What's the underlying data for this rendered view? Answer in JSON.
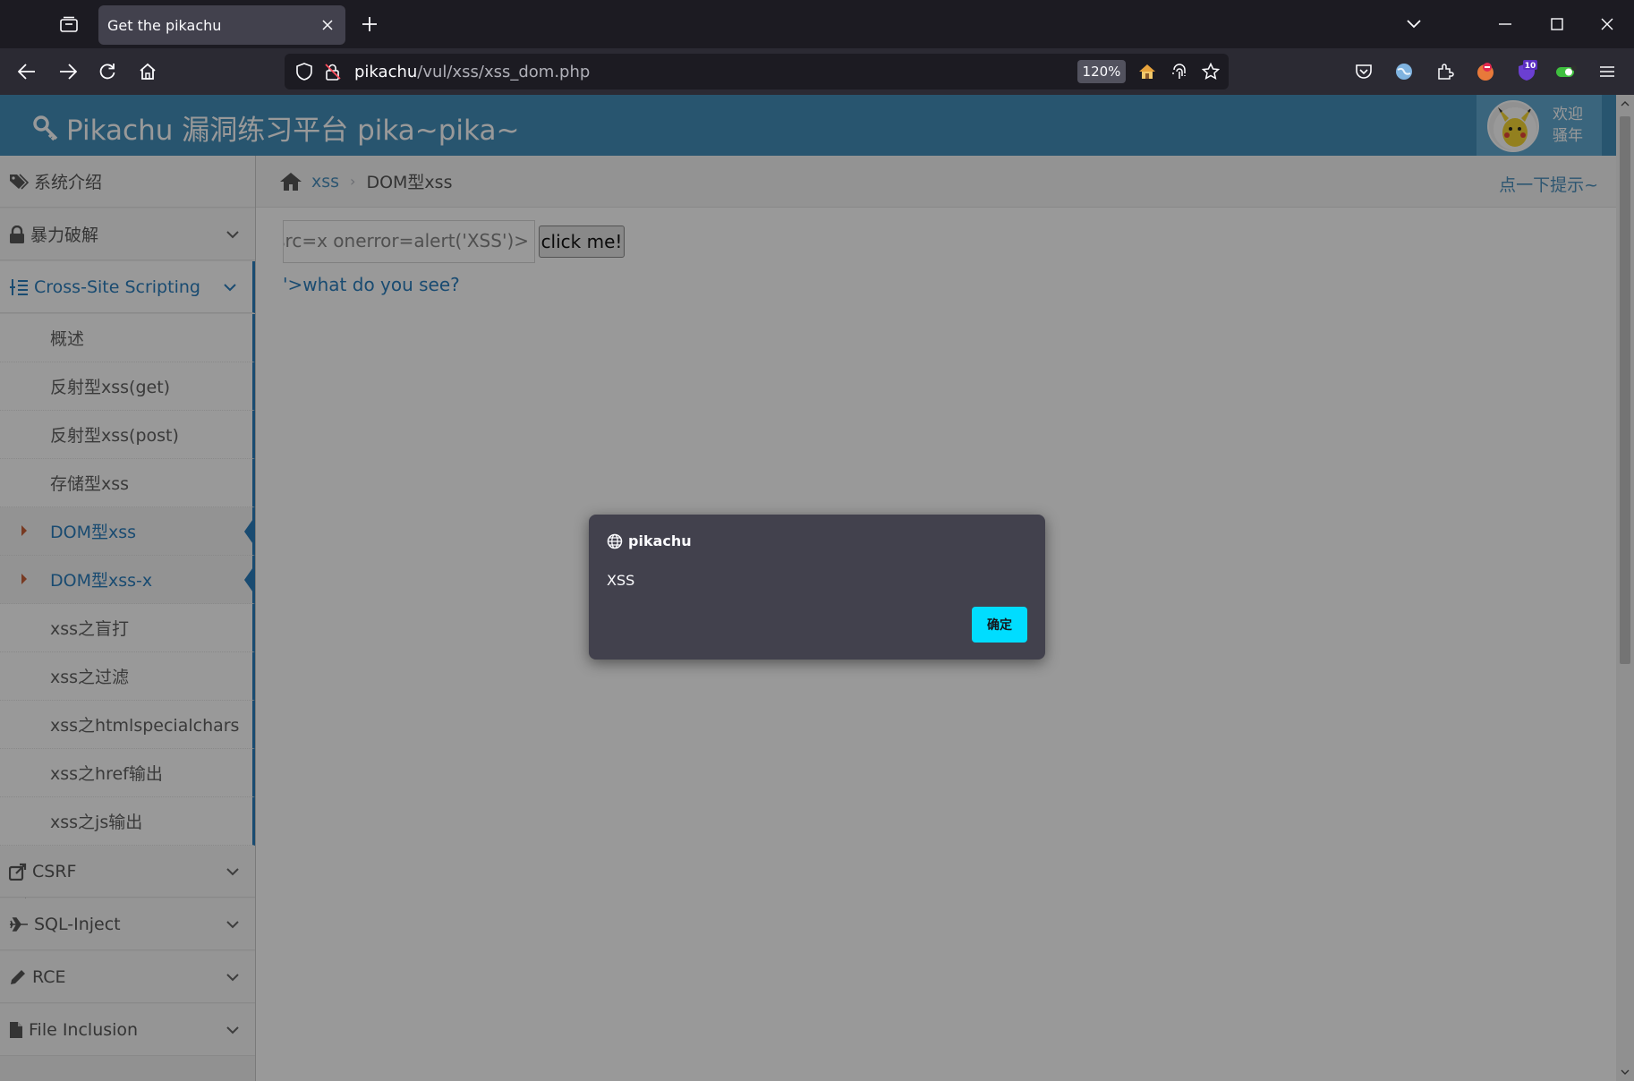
{
  "browser": {
    "tab_title": "Get the pikachu",
    "url_host": "pikachu",
    "url_path": "/vul/xss/xss_dom.php",
    "zoom": "120%"
  },
  "site": {
    "title": "Pikachu 漏洞练习平台 pika~pika~",
    "welcome_line1": "欢迎",
    "welcome_line2": "骚年"
  },
  "sidebar": {
    "intro": "系统介绍",
    "brute": "暴力破解",
    "xss": "Cross-Site Scripting",
    "xss_items": [
      "概述",
      "反射型xss(get)",
      "反射型xss(post)",
      "存储型xss",
      "DOM型xss",
      "DOM型xss-x",
      "xss之盲打",
      "xss之过滤",
      "xss之htmlspecialchars",
      "xss之href输出",
      "xss之js输出"
    ],
    "csrf": "CSRF",
    "sqli": "SQL-Inject",
    "rce": "RCE",
    "file_inclusion": "File Inclusion"
  },
  "breadcrumb": {
    "section": "xss",
    "current": "DOM型xss",
    "hint": "点一下提示~"
  },
  "main": {
    "input_value": "; src=x onerror=alert('XSS')>",
    "button_label": "click me!",
    "result_link": "'>what do you see?"
  },
  "dialog": {
    "origin": "pikachu",
    "message": "XSS",
    "ok_label": "确定"
  },
  "colors": {
    "header_blue": "#438eb9",
    "accent_blue": "#2b7dbc",
    "dialog_bg": "#42414d",
    "ok_button": "#00ddff"
  }
}
